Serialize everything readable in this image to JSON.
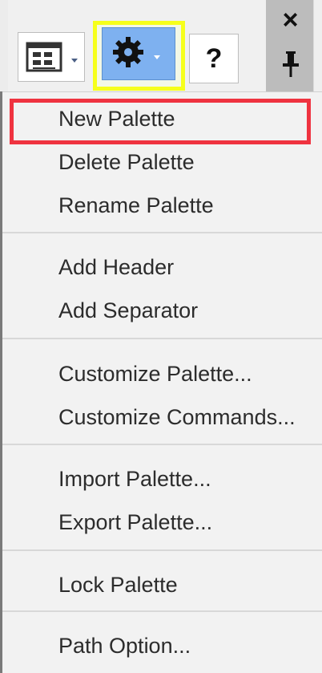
{
  "toolbar": {
    "layout_icon": "layout-icon",
    "settings_icon": "gear-icon",
    "help_label": "?",
    "close_label": "×",
    "pin_icon": "pin-icon"
  },
  "menu": {
    "items": [
      {
        "label": "New Palette"
      },
      {
        "label": "Delete Palette"
      },
      {
        "label": "Rename Palette"
      },
      {
        "label": "Add Header"
      },
      {
        "label": "Add Separator"
      },
      {
        "label": "Customize Palette..."
      },
      {
        "label": "Customize Commands..."
      },
      {
        "label": "Import Palette..."
      },
      {
        "label": "Export Palette..."
      },
      {
        "label": "Lock Palette"
      },
      {
        "label": "Path Option..."
      }
    ]
  },
  "colors": {
    "highlight_settings": "#f6ff1b",
    "highlight_menu_item": "#ef3340",
    "settings_button": "#7eb1f0"
  }
}
